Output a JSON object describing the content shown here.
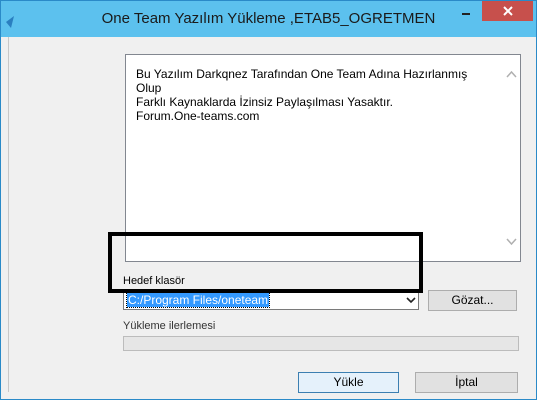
{
  "window": {
    "title": "One Team Yazılım Yükleme ,ETAB5_OGRETMEN",
    "minimize_label": "–",
    "close_label": "✕"
  },
  "info": {
    "lines": [
      "Bu Yazılım Darkqnez Tarafından One Team Adına Hazırlanmış",
      "Olup",
      "Farklı Kaynaklarda İzinsiz Paylaşılması Yasaktır.",
      "Forum.One-teams.com"
    ]
  },
  "target_folder": {
    "label": "Hedef klasör",
    "value": "C:/Program Files/oneteam",
    "browse_label": "Gözat..."
  },
  "progress": {
    "label": "Yükleme ilerlemesi",
    "value": 0
  },
  "buttons": {
    "install_label": "Yükle",
    "cancel_label": "İptal"
  },
  "colors": {
    "titlebar": "#5cc1ee",
    "close_button": "#c7504c",
    "selection": "#3399ff",
    "highlight_frame": "#000000"
  }
}
